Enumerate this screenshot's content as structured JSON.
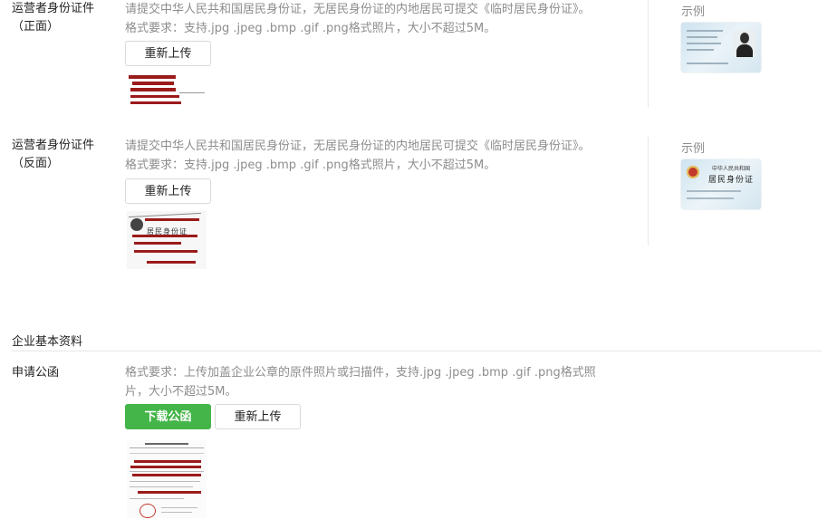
{
  "front": {
    "label_line1": "运营者身份证件",
    "label_line2": "（正面）",
    "desc_line1": "请提交中华人民共和国居民身份证，无居民身份证的内地居民可提交《临时居民身份证》。",
    "desc_line2": "格式要求：支持.jpg .jpeg .bmp .gif .png格式照片，大小不超过5M。",
    "reupload": "重新上传",
    "sample_label": "示例"
  },
  "back": {
    "label_line1": "运营者身份证件",
    "label_line2": "（反面）",
    "desc_line1": "请提交中华人民共和国居民身份证，无居民身份证的内地居民可提交《临时居民身份证》。",
    "desc_line2": "格式要求：支持.jpg .jpeg .bmp .gif .png格式照片，大小不超过5M。",
    "reupload": "重新上传",
    "sample_label": "示例",
    "sample_card_line1": "中华人民共和国",
    "sample_card_line2": "居民身份证",
    "upload_card_text": "居民身份证"
  },
  "section": {
    "title": "企业基本资料"
  },
  "letter": {
    "label": "申请公函",
    "desc_line1": "格式要求：上传加盖企业公章的原件照片或扫描件，支持.jpg .jpeg .bmp .gif .png格式照",
    "desc_line2": "片，大小不超过5M。",
    "download": "下载公函",
    "reupload": "重新上传"
  }
}
